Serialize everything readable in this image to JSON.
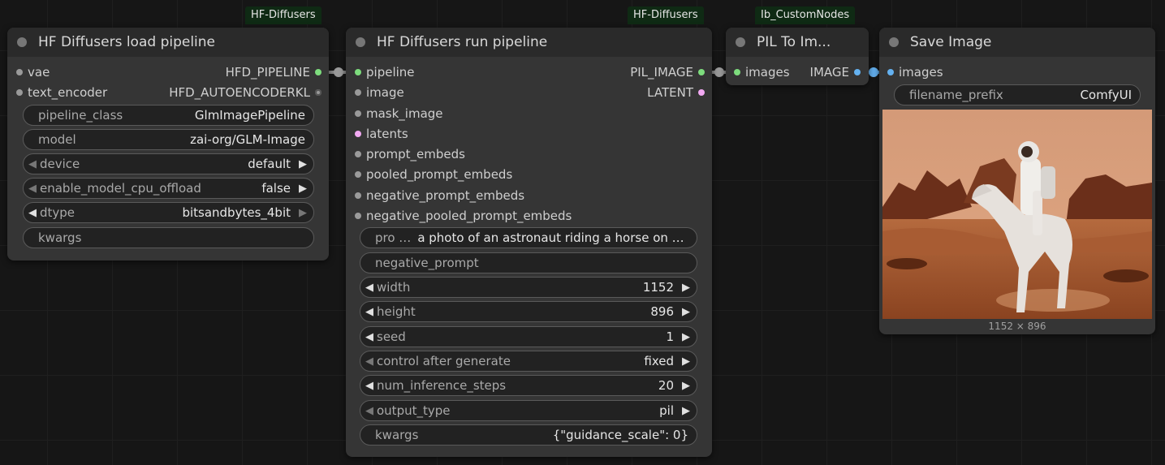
{
  "badges": {
    "load": "HF-Diffusers",
    "run": "HF-Diffusers",
    "pil": "Ib_CustomNodes"
  },
  "load_node": {
    "title": "HF Diffusers load pipeline",
    "inputs": [
      "vae",
      "text_encoder"
    ],
    "outputs": [
      "HFD_PIPELINE",
      "HFD_AUTOENCODERKL"
    ],
    "pipeline_class": {
      "label": "pipeline_class",
      "value": "GlmImagePipeline"
    },
    "model": {
      "label": "model",
      "value": "zai-org/GLM-Image"
    },
    "device": {
      "label": "device",
      "value": "default"
    },
    "offload": {
      "label": "enable_model_cpu_offload",
      "value": "false"
    },
    "dtype": {
      "label": "dtype",
      "value": "bitsandbytes_4bit"
    },
    "kwargs": {
      "label": "kwargs",
      "value": ""
    }
  },
  "run_node": {
    "title": "HF Diffusers run pipeline",
    "inputs": [
      "pipeline",
      "image",
      "mask_image",
      "latents",
      "prompt_embeds",
      "pooled_prompt_embeds",
      "negative_prompt_embeds",
      "negative_pooled_prompt_embeds"
    ],
    "outputs": [
      "PIL_IMAGE",
      "LATENT"
    ],
    "prompt": {
      "label": "pro …",
      "value": "a photo of an astronaut riding a horse on mars"
    },
    "negative_prompt": {
      "label": "negative_prompt",
      "value": ""
    },
    "width": {
      "label": "width",
      "value": "1152"
    },
    "height": {
      "label": "height",
      "value": "896"
    },
    "seed": {
      "label": "seed",
      "value": "1"
    },
    "control": {
      "label": "control after generate",
      "value": "fixed"
    },
    "steps": {
      "label": "num_inference_steps",
      "value": "20"
    },
    "output_type": {
      "label": "output_type",
      "value": "pil"
    },
    "kwargs": {
      "label": "kwargs",
      "value": "{\"guidance_scale\": 0}"
    }
  },
  "pil_node": {
    "title": "PIL To Im...",
    "input": "images",
    "output": "IMAGE"
  },
  "save_node": {
    "title": "Save Image",
    "input": "images",
    "filename_prefix": {
      "label": "filename_prefix",
      "value": "ComfyUI"
    },
    "image_caption": "1152 × 896"
  },
  "colors": {
    "pipeline_link": "#7ddc7d",
    "latent_link": "#f2a9f2",
    "image_link": "#64b1f0",
    "badge_bg": "#0f2a14"
  },
  "icons": {
    "left_arrow": "◀",
    "right_arrow": "▶"
  }
}
